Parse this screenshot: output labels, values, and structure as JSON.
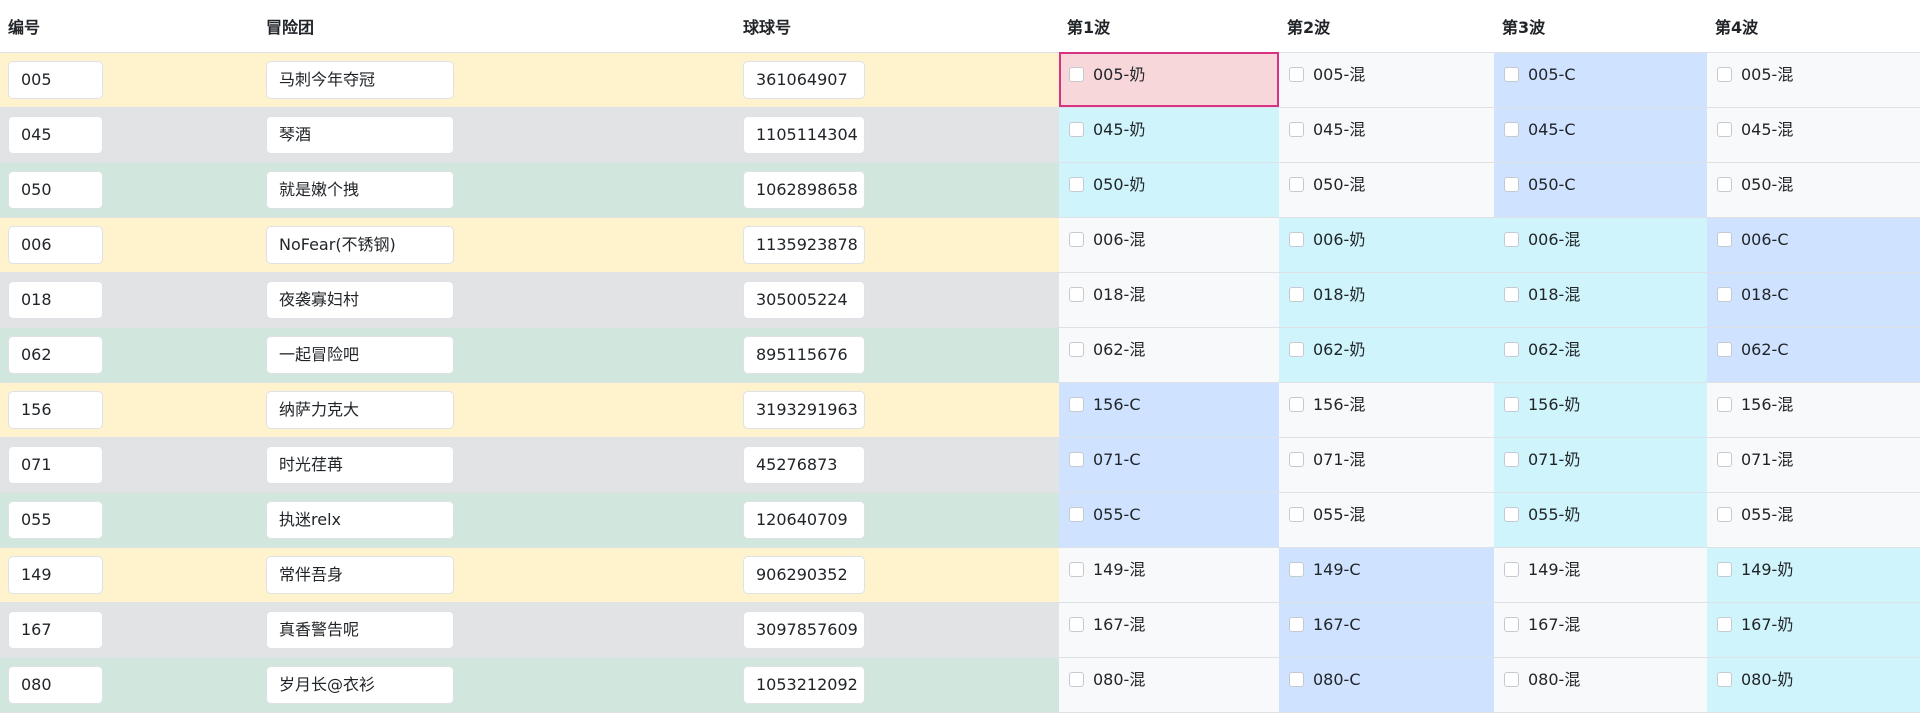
{
  "headers": {
    "id": "编号",
    "team": "冒险团",
    "qq": "球球号",
    "waves": [
      "第1波",
      "第2波",
      "第3波",
      "第4波"
    ]
  },
  "colors": {
    "yellow": "#fff3cd",
    "gray": "#e2e3e5",
    "green": "#d1e7dd",
    "pink": "#f8d7da",
    "cyan": "#cff4fc",
    "blue": "#cfe2ff",
    "light": "#f8f9fa",
    "selected_border": "#d63384"
  },
  "rows": [
    {
      "tone": "yellow",
      "id": "005",
      "team": "马刺今年夺冠",
      "qq": "361064907",
      "waves": [
        {
          "label": "005-奶",
          "tone": "pink",
          "selected": true
        },
        {
          "label": "005-混",
          "tone": "light"
        },
        {
          "label": "005-C",
          "tone": "blue"
        },
        {
          "label": "005-混",
          "tone": "light"
        }
      ]
    },
    {
      "tone": "gray",
      "id": "045",
      "team": "琴酒",
      "qq": "1105114304",
      "waves": [
        {
          "label": "045-奶",
          "tone": "cyan"
        },
        {
          "label": "045-混",
          "tone": "light"
        },
        {
          "label": "045-C",
          "tone": "blue"
        },
        {
          "label": "045-混",
          "tone": "light"
        }
      ]
    },
    {
      "tone": "green",
      "id": "050",
      "team": "就是嫩个拽",
      "qq": "1062898658",
      "waves": [
        {
          "label": "050-奶",
          "tone": "cyan"
        },
        {
          "label": "050-混",
          "tone": "light"
        },
        {
          "label": "050-C",
          "tone": "blue"
        },
        {
          "label": "050-混",
          "tone": "light"
        }
      ]
    },
    {
      "tone": "yellow",
      "id": "006",
      "team": "NoFear(不锈钢)",
      "qq": "1135923878",
      "waves": [
        {
          "label": "006-混",
          "tone": "light"
        },
        {
          "label": "006-奶",
          "tone": "cyan"
        },
        {
          "label": "006-混",
          "tone": "cyan"
        },
        {
          "label": "006-C",
          "tone": "blue"
        }
      ]
    },
    {
      "tone": "gray",
      "id": "018",
      "team": "夜袭寡妇村",
      "qq": "305005224",
      "waves": [
        {
          "label": "018-混",
          "tone": "light"
        },
        {
          "label": "018-奶",
          "tone": "cyan"
        },
        {
          "label": "018-混",
          "tone": "cyan"
        },
        {
          "label": "018-C",
          "tone": "blue"
        }
      ]
    },
    {
      "tone": "green",
      "id": "062",
      "team": "一起冒险吧",
      "qq": "895115676",
      "waves": [
        {
          "label": "062-混",
          "tone": "light"
        },
        {
          "label": "062-奶",
          "tone": "cyan"
        },
        {
          "label": "062-混",
          "tone": "cyan"
        },
        {
          "label": "062-C",
          "tone": "blue"
        }
      ]
    },
    {
      "tone": "yellow",
      "id": "156",
      "team": "纳萨力克大",
      "qq": "3193291963",
      "waves": [
        {
          "label": "156-C",
          "tone": "blue"
        },
        {
          "label": "156-混",
          "tone": "light"
        },
        {
          "label": "156-奶",
          "tone": "cyan"
        },
        {
          "label": "156-混",
          "tone": "light"
        }
      ]
    },
    {
      "tone": "gray",
      "id": "071",
      "team": "时光荏苒",
      "qq": "45276873",
      "waves": [
        {
          "label": "071-C",
          "tone": "blue"
        },
        {
          "label": "071-混",
          "tone": "light"
        },
        {
          "label": "071-奶",
          "tone": "cyan"
        },
        {
          "label": "071-混",
          "tone": "light"
        }
      ]
    },
    {
      "tone": "green",
      "id": "055",
      "team": "执迷relx",
      "qq": "120640709",
      "waves": [
        {
          "label": "055-C",
          "tone": "blue"
        },
        {
          "label": "055-混",
          "tone": "light"
        },
        {
          "label": "055-奶",
          "tone": "cyan"
        },
        {
          "label": "055-混",
          "tone": "light"
        }
      ]
    },
    {
      "tone": "yellow",
      "id": "149",
      "team": "常伴吾身",
      "qq": "906290352",
      "waves": [
        {
          "label": "149-混",
          "tone": "light"
        },
        {
          "label": "149-C",
          "tone": "blue"
        },
        {
          "label": "149-混",
          "tone": "light"
        },
        {
          "label": "149-奶",
          "tone": "cyan"
        }
      ]
    },
    {
      "tone": "gray",
      "id": "167",
      "team": "真香警告呢",
      "qq": "3097857609",
      "waves": [
        {
          "label": "167-混",
          "tone": "light"
        },
        {
          "label": "167-C",
          "tone": "blue"
        },
        {
          "label": "167-混",
          "tone": "light"
        },
        {
          "label": "167-奶",
          "tone": "cyan"
        }
      ]
    },
    {
      "tone": "green",
      "id": "080",
      "team": "岁月长@衣衫",
      "qq": "1053212092",
      "waves": [
        {
          "label": "080-混",
          "tone": "light"
        },
        {
          "label": "080-C",
          "tone": "blue"
        },
        {
          "label": "080-混",
          "tone": "light"
        },
        {
          "label": "080-奶",
          "tone": "cyan"
        }
      ]
    }
  ]
}
